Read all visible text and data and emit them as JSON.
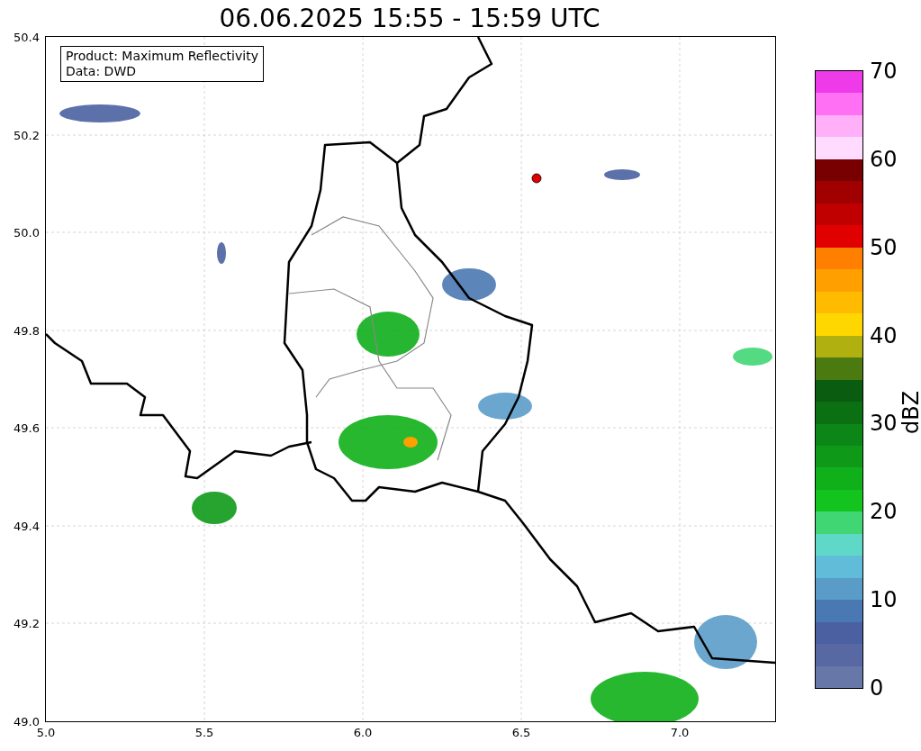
{
  "title": "06.06.2025 15:55 - 15:59 UTC",
  "annotation": {
    "lines": [
      "Product: Maximum Reflectivity",
      "Data: DWD"
    ]
  },
  "x_axis": {
    "ticks": [
      "5.0",
      "5.5",
      "6.0",
      "6.5",
      "7.0"
    ]
  },
  "y_axis": {
    "ticks": [
      "50.4",
      "50.2",
      "50.0",
      "49.8",
      "49.6",
      "49.4",
      "49.2",
      "49.0"
    ]
  },
  "colorbar": {
    "label": "dBZ",
    "ticks": [
      "70",
      "60",
      "50",
      "40",
      "30",
      "20",
      "10",
      "0"
    ],
    "segments": [
      {
        "color": "#ee3ae8"
      },
      {
        "color": "#ff70f4"
      },
      {
        "color": "#ffb0f8"
      },
      {
        "color": "#ffdcff"
      },
      {
        "color": "#780000"
      },
      {
        "color": "#a00000"
      },
      {
        "color": "#c00000"
      },
      {
        "color": "#e00000"
      },
      {
        "color": "#ff8000"
      },
      {
        "color": "#ffa000"
      },
      {
        "color": "#ffbb00"
      },
      {
        "color": "#ffd700"
      },
      {
        "color": "#b0b010"
      },
      {
        "color": "#4a7a10"
      },
      {
        "color": "#0a5c10"
      },
      {
        "color": "#0a7012"
      },
      {
        "color": "#0c8616"
      },
      {
        "color": "#0e9a18"
      },
      {
        "color": "#10b01a"
      },
      {
        "color": "#14c41e"
      },
      {
        "color": "#40d674"
      },
      {
        "color": "#60d8c8"
      },
      {
        "color": "#60bcd8"
      },
      {
        "color": "#5a9cc8"
      },
      {
        "color": "#4a78b2"
      },
      {
        "color": "#4a60a0"
      },
      {
        "color": "#5868a2"
      },
      {
        "color": "#6677a8"
      }
    ]
  }
}
